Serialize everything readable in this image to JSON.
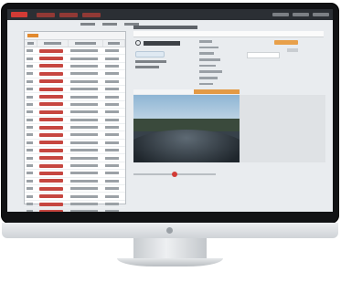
{
  "window": {
    "title": "",
    "topbar": {
      "tabs": 3,
      "right_items": 3
    }
  },
  "toolbar": {
    "items": 3
  },
  "list_panel": {
    "title": "",
    "columns": [
      "",
      "",
      "",
      ""
    ],
    "rows": [
      {
        "c1": "",
        "c2": "",
        "c3": "",
        "c4": ""
      },
      {
        "c1": "",
        "c2": "",
        "c3": "",
        "c4": ""
      },
      {
        "c1": "",
        "c2": "",
        "c3": "",
        "c4": ""
      },
      {
        "c1": "",
        "c2": "",
        "c3": "",
        "c4": ""
      },
      {
        "c1": "",
        "c2": "",
        "c3": "",
        "c4": ""
      },
      {
        "c1": "",
        "c2": "",
        "c3": "",
        "c4": ""
      },
      {
        "c1": "",
        "c2": "",
        "c3": "",
        "c4": ""
      },
      {
        "c1": "",
        "c2": "",
        "c3": "",
        "c4": ""
      },
      {
        "c1": "",
        "c2": "",
        "c3": "",
        "c4": ""
      },
      {
        "c1": "",
        "c2": "",
        "c3": "",
        "c4": ""
      },
      {
        "c1": "",
        "c2": "",
        "c3": "",
        "c4": ""
      },
      {
        "c1": "",
        "c2": "",
        "c3": "",
        "c4": ""
      },
      {
        "c1": "",
        "c2": "",
        "c3": "",
        "c4": ""
      },
      {
        "c1": "",
        "c2": "",
        "c3": "",
        "c4": ""
      },
      {
        "c1": "",
        "c2": "",
        "c3": "",
        "c4": ""
      },
      {
        "c1": "",
        "c2": "",
        "c3": "",
        "c4": ""
      },
      {
        "c1": "",
        "c2": "",
        "c3": "",
        "c4": ""
      },
      {
        "c1": "",
        "c2": "",
        "c3": "",
        "c4": ""
      },
      {
        "c1": "",
        "c2": "",
        "c3": "",
        "c4": ""
      },
      {
        "c1": "",
        "c2": "",
        "c3": "",
        "c4": ""
      },
      {
        "c1": "",
        "c2": "",
        "c3": "",
        "c4": ""
      },
      {
        "c1": "",
        "c2": "",
        "c3": "",
        "c4": ""
      }
    ]
  },
  "detail": {
    "title": "",
    "timestamp": "",
    "info": [
      "",
      ""
    ],
    "menu_items": 9,
    "video_label": "",
    "video_progress": 0.5
  },
  "colors": {
    "accent": "#d23b35",
    "orange": "#e8a04a",
    "topbar": "#2b2f34"
  },
  "icons": [
    "clock-icon",
    "logo-icon"
  ]
}
